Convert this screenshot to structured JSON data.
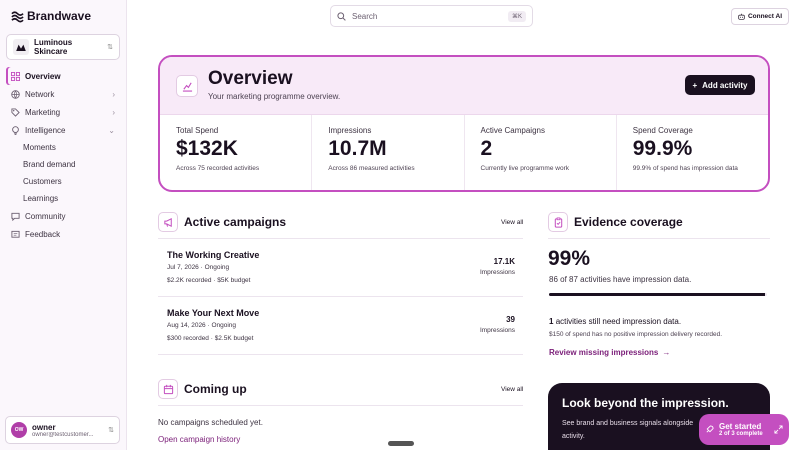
{
  "brand": {
    "name": "Brandwave"
  },
  "org": {
    "name": "Luminous Skincare"
  },
  "nav": {
    "overview": "Overview",
    "network": "Network",
    "marketing": "Marketing",
    "intelligence": "Intelligence",
    "sub": [
      "Moments",
      "Brand demand",
      "Customers",
      "Learnings"
    ],
    "community": "Community",
    "feedback": "Feedback"
  },
  "user": {
    "initials": "OW",
    "name": "owner",
    "email": "owner@testcustomer..."
  },
  "search": {
    "placeholder": "Search",
    "shortcut": "⌘K"
  },
  "connect_label": "Connect AI",
  "overview": {
    "title": "Overview",
    "subtitle": "Your marketing programme overview.",
    "add_label": "Add activity",
    "stats": [
      {
        "label": "Total Spend",
        "value": "$132K",
        "note": "Across 75 recorded activities"
      },
      {
        "label": "Impressions",
        "value": "10.7M",
        "note": "Across 86 measured activities"
      },
      {
        "label": "Active Campaigns",
        "value": "2",
        "note": "Currently live programme work"
      },
      {
        "label": "Spend Coverage",
        "value": "99.9%",
        "note": "99.9% of spend has impression data"
      }
    ]
  },
  "campaigns": {
    "title": "Active campaigns",
    "view_all": "View all",
    "rows": [
      {
        "name": "The Working Creative",
        "date": "Jul 7, 2026 · Ongoing",
        "budget": "$2.2K recorded · $5K budget",
        "value": "17.1K",
        "unit": "Impressions"
      },
      {
        "name": "Make Your Next Move",
        "date": "Aug 14, 2026 · Ongoing",
        "budget": "$300 recorded · $2.5K budget",
        "value": "39",
        "unit": "Impressions"
      }
    ]
  },
  "evidence": {
    "title": "Evidence coverage",
    "percent": "99%",
    "fill": 0.99,
    "text": "86 of 87 activities have impression data.",
    "still_count": "1",
    "still_text": "activities still need impression data.",
    "spend_text": "$150 of spend has no positive impression delivery recorded.",
    "link": "Review missing impressions"
  },
  "coming_up": {
    "title": "Coming up",
    "view_all": "View all",
    "empty": "No campaigns scheduled yet.",
    "link": "Open campaign history"
  },
  "promo": {
    "title": "Look beyond the impression.",
    "body": "See brand and business signals alongside activity."
  },
  "get_started": {
    "title": "Get started",
    "sub": "2 of 3 complete"
  }
}
